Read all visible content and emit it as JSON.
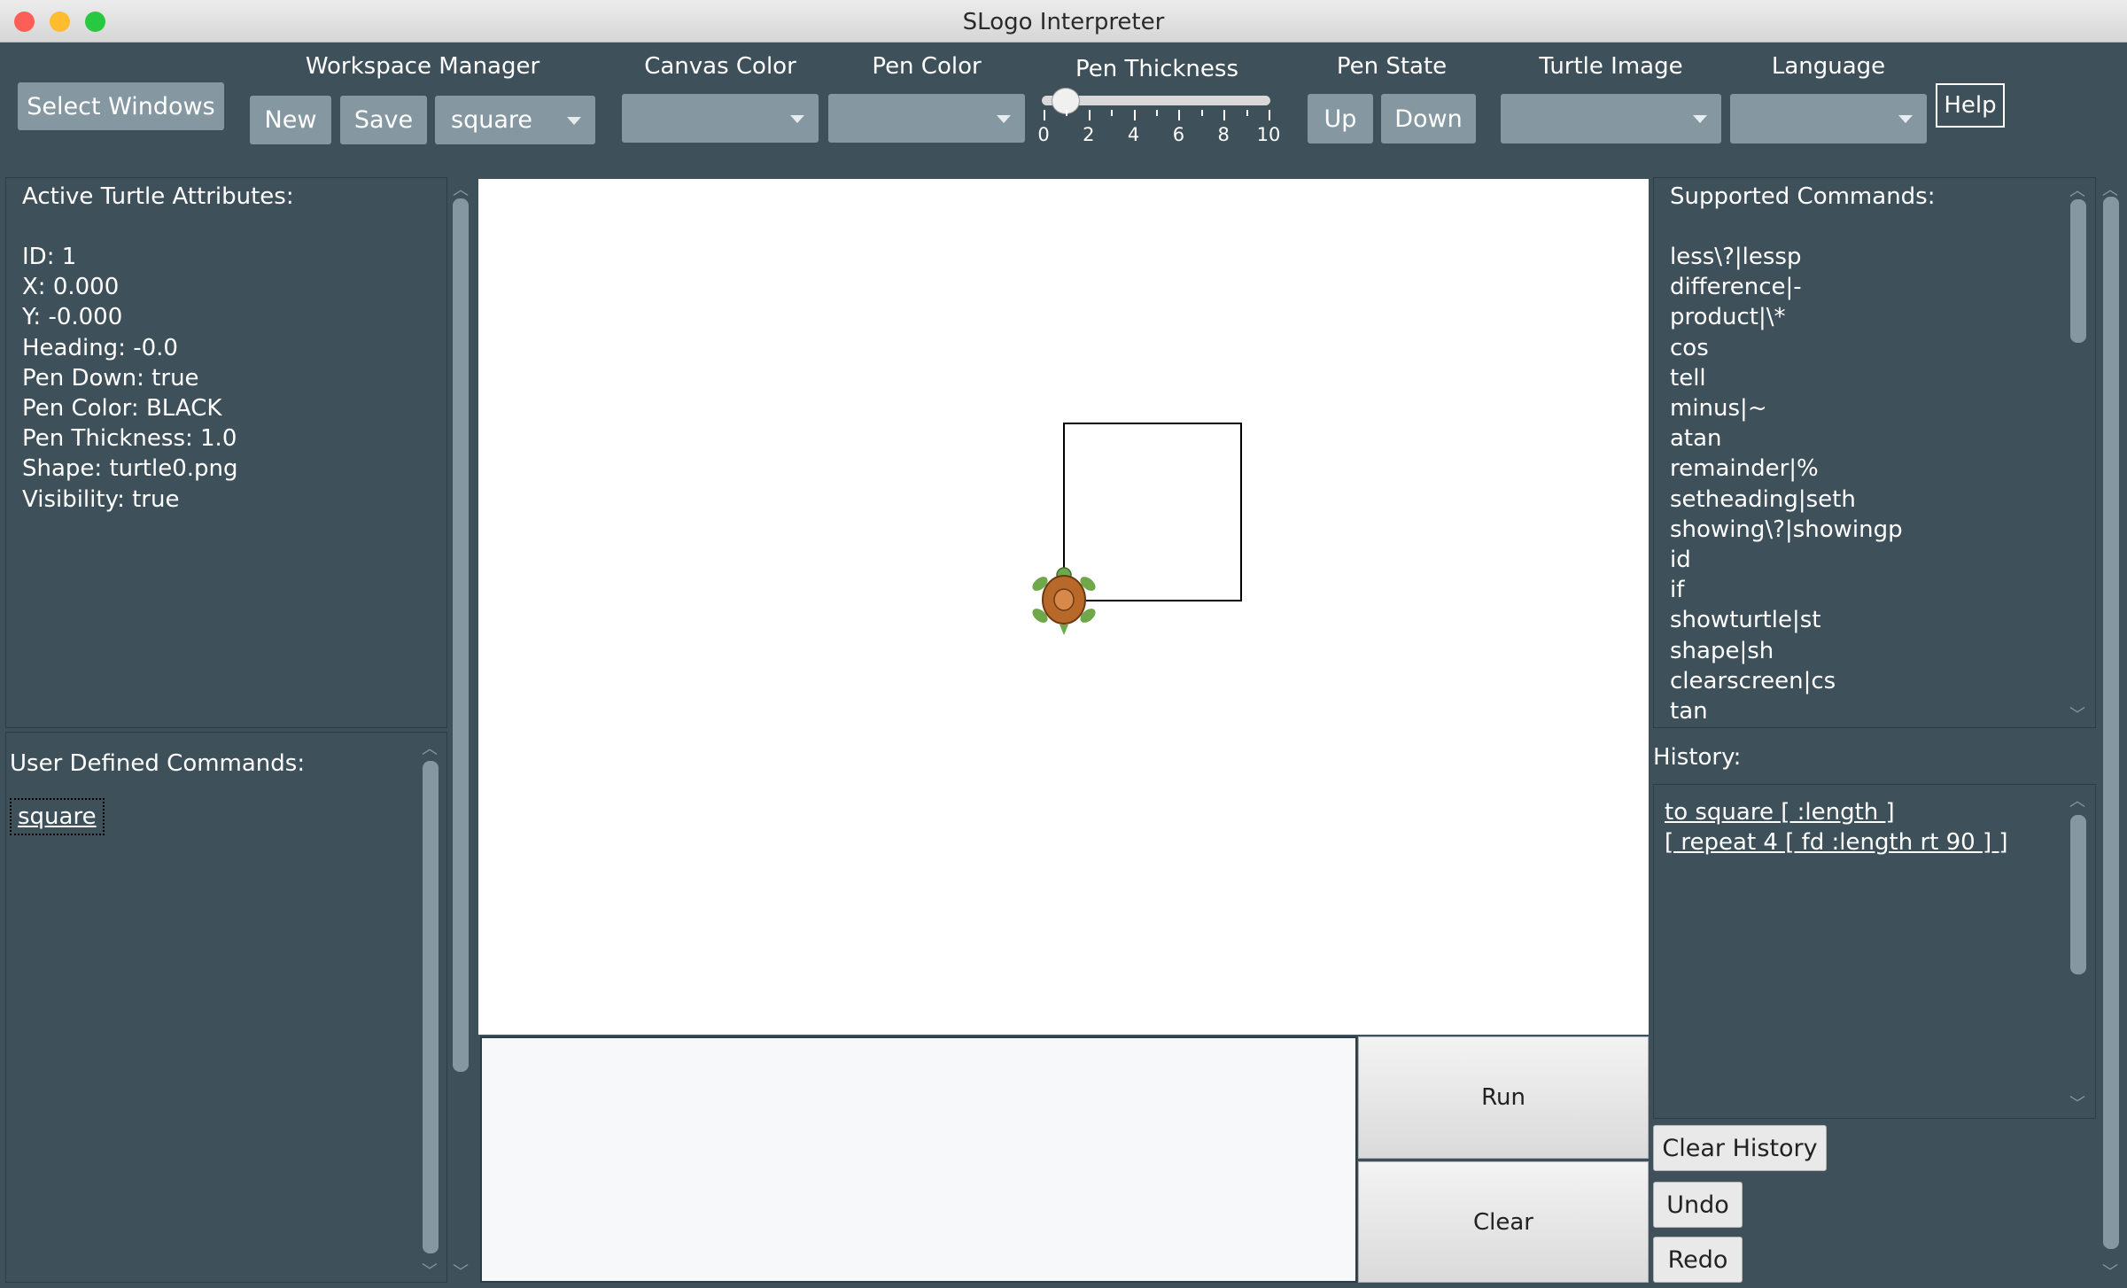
{
  "window": {
    "title": "SLogo Interpreter"
  },
  "toolbar": {
    "select_windows": "Select Windows",
    "workspace_manager_label": "Workspace Manager",
    "new_label": "New",
    "save_label": "Save",
    "workspace_selected": "square",
    "canvas_color_label": "Canvas Color",
    "canvas_color_value": "",
    "pen_color_label": "Pen Color",
    "pen_color_value": "",
    "pen_thickness_label": "Pen Thickness",
    "pen_thickness_value": 1,
    "pen_thickness_ticks": [
      "0",
      "2",
      "4",
      "6",
      "8",
      "10"
    ],
    "pen_state_label": "Pen State",
    "up_label": "Up",
    "down_label": "Down",
    "turtle_image_label": "Turtle Image",
    "turtle_image_value": "",
    "language_label": "Language",
    "language_value": "",
    "help_label": "Help"
  },
  "attributes": {
    "heading": "Active Turtle Attributes:",
    "lines": [
      "ID: 1",
      "X: 0.000",
      "Y: -0.000",
      "Heading:  -0.0",
      "Pen Down: true",
      "Pen Color: BLACK",
      "Pen Thickness: 1.0",
      "Shape: turtle0.png",
      "Visibility: true"
    ]
  },
  "user_commands": {
    "heading": "User Defined Commands:",
    "items": [
      "square"
    ]
  },
  "supported": {
    "heading": "Supported Commands:",
    "items": [
      "less\\?|lessp",
      "difference|-",
      "product|\\*",
      "cos",
      "tell",
      "minus|~",
      "atan",
      "remainder|%",
      "setheading|seth",
      "showing\\?|showingp",
      "id",
      "if",
      "showturtle|st",
      "shape|sh",
      "clearscreen|cs",
      "tan"
    ]
  },
  "history": {
    "heading": "History:",
    "items": [
      "to square [ :length ]",
      " [ repeat 4 [ fd :length rt 90 ] ]"
    ]
  },
  "console": {
    "input_value": "",
    "run_label": "Run",
    "clear_label": "Clear"
  },
  "history_buttons": {
    "clear_history": "Clear History",
    "undo": "Undo",
    "redo": "Redo"
  },
  "colors": {
    "panel_bg": "#3e505a",
    "control": "#8598a2",
    "canvas": "#ffffff",
    "pen": "#000000"
  }
}
